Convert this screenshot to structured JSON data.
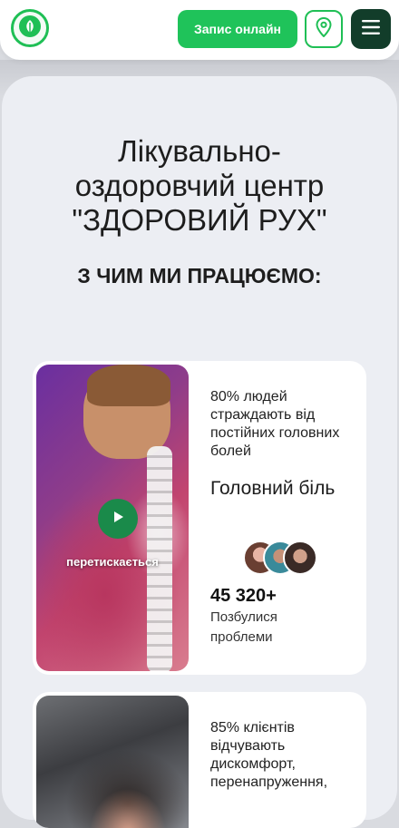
{
  "header": {
    "book_label": "Запис онлайн",
    "logo_icon": "leaf-icon",
    "map_icon": "map-pin-icon",
    "menu_icon": "hamburger-menu-icon",
    "accent": "#1fc35a",
    "menu_bg": "#123d2a"
  },
  "hero": {
    "title_line1": "Лікувально-",
    "title_line2": "оздоровчий центр",
    "title_line3": "\"ЗДОРОВИЙ РУХ\"",
    "subtitle": "З ЧИМ МИ ПРАЦЮЄМО:"
  },
  "cards": [
    {
      "description": "80% людей страждають від постійних головних болей",
      "condition": "Головний біль",
      "count": "45 320+",
      "count_label": "Позбулися проблеми",
      "video_caption": "перетискається"
    },
    {
      "description": "85% клієнтів відчувають дискомфорт, перенапруження,"
    }
  ]
}
